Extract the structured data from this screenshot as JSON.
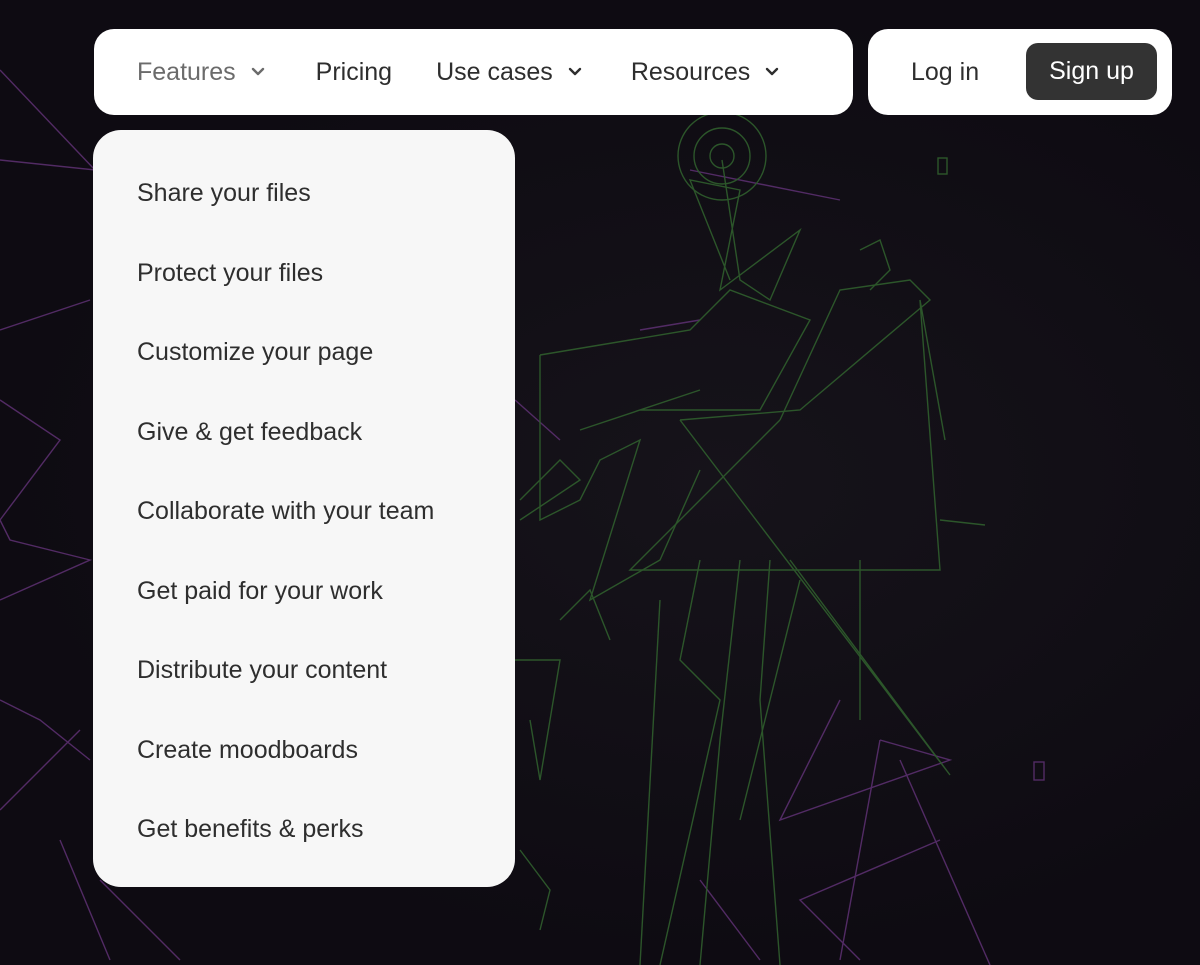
{
  "nav": {
    "features_label": "Features",
    "pricing_label": "Pricing",
    "use_cases_label": "Use cases",
    "resources_label": "Resources"
  },
  "auth": {
    "login_label": "Log in",
    "signup_label": "Sign up"
  },
  "features_menu": {
    "items": [
      {
        "label": "Share your files"
      },
      {
        "label": "Protect your files"
      },
      {
        "label": "Customize your page"
      },
      {
        "label": "Give & get feedback"
      },
      {
        "label": "Collaborate with your team"
      },
      {
        "label": "Get paid for your work"
      },
      {
        "label": "Distribute your content"
      },
      {
        "label": "Create moodboards"
      },
      {
        "label": "Get benefits & perks"
      }
    ]
  },
  "colors": {
    "background": "#0f0c13",
    "pill": "#ffffff",
    "signup_button": "#333333",
    "menu_panel": "#f7f7f7",
    "text": "#2e2e2e",
    "art_green": "#2e5a2c",
    "art_purple": "#5a2f6e"
  },
  "icons": {
    "dropdown": "chevron-down-icon"
  }
}
